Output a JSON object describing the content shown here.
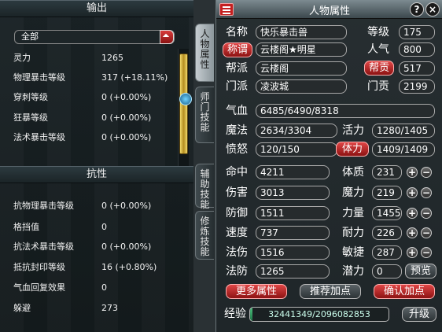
{
  "left": {
    "output_header": "输出",
    "filter_value": "全部",
    "output_stats": [
      {
        "label": "灵力",
        "value": "1265"
      },
      {
        "label": "物理暴击等级",
        "value": "317 (+18.11%)"
      },
      {
        "label": "穿刺等级",
        "value": "0 (+0.00%)"
      },
      {
        "label": "狂暴等级",
        "value": "0 (+0.00%)"
      },
      {
        "label": "法术暴击等级",
        "value": "0 (+0.00%)"
      }
    ],
    "resist_header": "抗性",
    "resist_stats": [
      {
        "label": "抗物理暴击等级",
        "value": "0 (+0.00%)"
      },
      {
        "label": "格挡值",
        "value": "0"
      },
      {
        "label": "抗法术暴击等级",
        "value": "0 (+0.00%)"
      },
      {
        "label": "抵抗封印等级",
        "value": "16 (+0.80%)"
      },
      {
        "label": "气血回复效果",
        "value": "0"
      },
      {
        "label": "躲避",
        "value": "273"
      }
    ]
  },
  "tabs": [
    {
      "label": "人物属性"
    },
    {
      "label": "师门技能"
    },
    {
      "label": "辅助技能"
    },
    {
      "label": "修炼技能"
    }
  ],
  "panel": {
    "title": "人物属性",
    "help": "?",
    "close": "×",
    "name_label": "名称",
    "name": "快乐暴击兽",
    "level_label": "等级",
    "level": "175",
    "title_btn": "称谓",
    "title_value": "云楼阁★明星",
    "popularity_label": "人气",
    "popularity": "800",
    "gang_label": "帮派",
    "gang": "云楼阁",
    "contribution_btn": "帮贡",
    "contribution": "517",
    "school_label": "门派",
    "school": "凌波城",
    "school_contrib_label": "门贡",
    "school_contrib": "2199",
    "hp_label": "气血",
    "hp": "6485/6490/8318",
    "mp_label": "魔法",
    "mp": "2634/3304",
    "vitality_label": "活力",
    "vitality": "1280/1405",
    "rage_label": "愤怒",
    "rage": "120/150",
    "stamina_btn": "体力",
    "stamina": "1409/1409",
    "hit_label": "命中",
    "hit": "4211",
    "con_label": "体质",
    "con": "231",
    "dmg_label": "伤害",
    "dmg": "3013",
    "mag_label": "魔力",
    "mag": "219",
    "def_label": "防御",
    "def": "1511",
    "str_label": "力量",
    "str": "1455",
    "spd_label": "速度",
    "spd": "737",
    "end_label": "耐力",
    "end": "226",
    "mdmg_label": "法伤",
    "mdmg": "1516",
    "agi_label": "敏捷",
    "agi": "287",
    "mdef_label": "法防",
    "mdef": "1265",
    "potential_label": "潜力",
    "potential": "0",
    "preview_btn": "预览",
    "more_btn": "更多属性",
    "recommend_btn": "推荐加点",
    "confirm_btn": "确认加点",
    "exp_label": "经验",
    "exp": "32441349/2096082853",
    "exp_fraction": 0.0155,
    "upgrade_btn": "升级",
    "plus": "+",
    "minus": "−"
  }
}
